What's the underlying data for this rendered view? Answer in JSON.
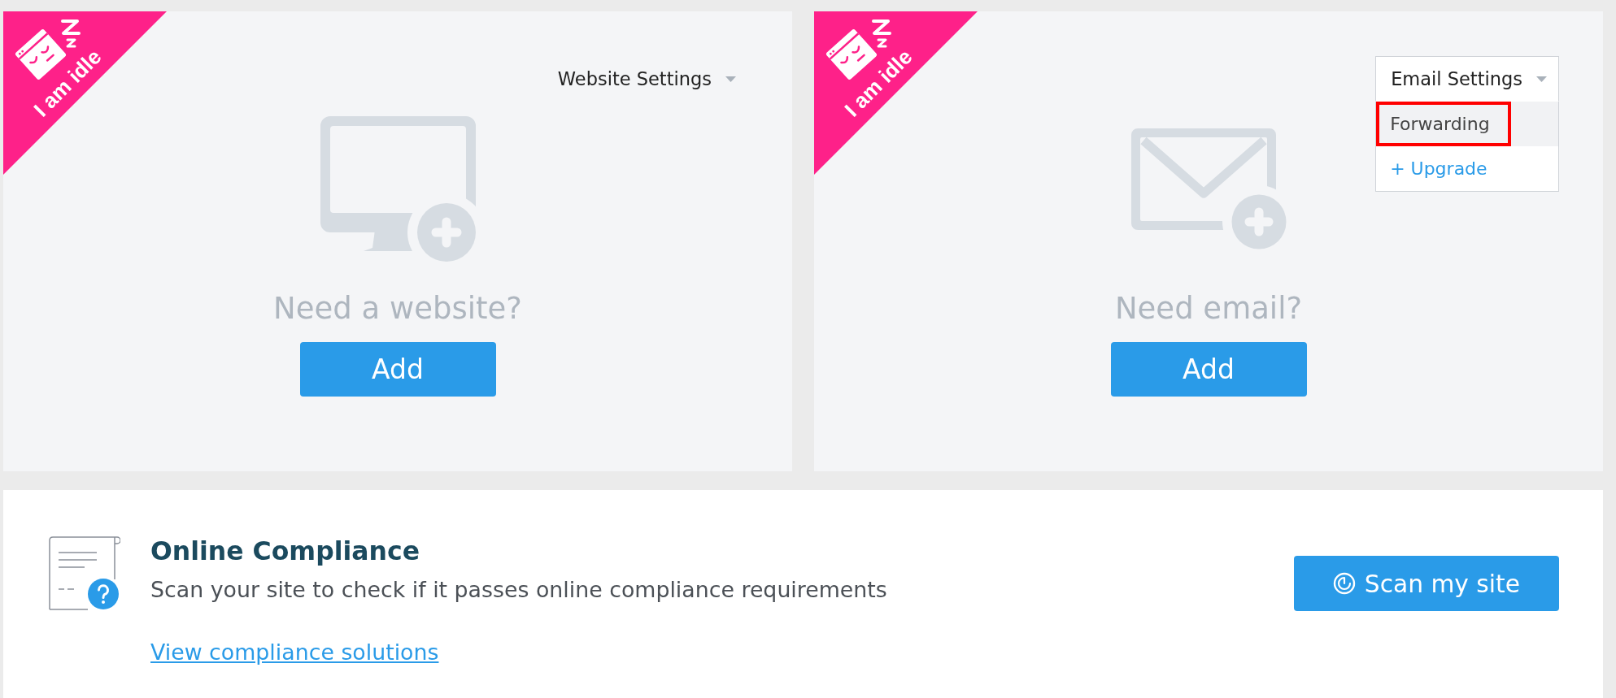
{
  "cards": [
    {
      "kind": "website",
      "badge": {
        "label": "I am idle"
      },
      "dropdown": {
        "label": "Website Settings",
        "open": false
      },
      "prompt": "Need a website?",
      "button": "Add"
    },
    {
      "kind": "email",
      "badge": {
        "label": "I am idle"
      },
      "dropdown": {
        "label": "Email Settings",
        "open": true,
        "items": [
          {
            "label": "Forwarding",
            "kind": "option",
            "selected": true,
            "outlined": true
          },
          {
            "label": "+ Upgrade",
            "kind": "upgrade",
            "selected": false,
            "outlined": false
          }
        ]
      },
      "prompt": "Need email?",
      "button": "Add"
    }
  ],
  "compliance": {
    "title": "Online Compliance",
    "description": "Scan your site to check if it passes online compliance requirements",
    "link": "View compliance solutions",
    "button": "Scan my site"
  }
}
